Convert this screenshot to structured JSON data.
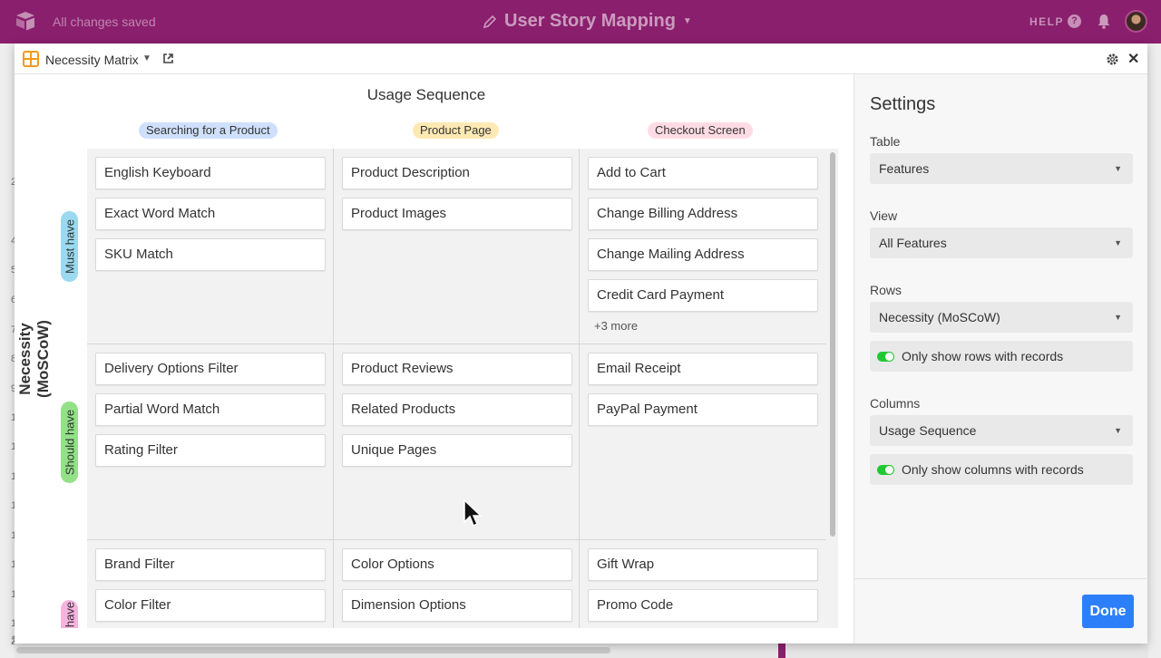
{
  "topbar": {
    "saved_status": "All changes saved",
    "base_name": "User Story Mapping",
    "help_label": "HELP",
    "help_icon": "?"
  },
  "background_row_numbers": [
    "2",
    "4",
    "5",
    "6",
    "7",
    "8",
    "9",
    "1",
    "1",
    "1",
    "1",
    "1",
    "1",
    "1",
    "1",
    "1",
    "2"
  ],
  "block": {
    "name": "Necessity Matrix",
    "close_glyph": "✕"
  },
  "matrix": {
    "column_field": "Usage Sequence",
    "row_field": "Necessity (MoSCoW)",
    "columns": [
      "Searching for a Product",
      "Product Page",
      "Checkout Screen"
    ],
    "rows": [
      "Must have",
      "Should have",
      "have"
    ],
    "cells": {
      "r0c0": [
        "English Keyboard",
        "Exact Word Match",
        "SKU Match"
      ],
      "r0c1": [
        "Product Description",
        "Product Images"
      ],
      "r0c2": [
        "Add to Cart",
        "Change Billing Address",
        "Change Mailing Address",
        "Credit Card Payment"
      ],
      "r0c2_more": "+3 more",
      "r1c0": [
        "Delivery Options Filter",
        "Partial Word Match",
        "Rating Filter"
      ],
      "r1c1": [
        "Product Reviews",
        "Related Products",
        "Unique Pages"
      ],
      "r1c2": [
        "Email Receipt",
        "PayPal Payment"
      ],
      "r2c0": [
        "Brand Filter",
        "Color Filter"
      ],
      "r2c1": [
        "Color Options",
        "Dimension Options"
      ],
      "r2c2": [
        "Gift Wrap",
        "Promo Code"
      ]
    }
  },
  "settings": {
    "heading": "Settings",
    "table_label": "Table",
    "table_value": "Features",
    "view_label": "View",
    "view_value": "All Features",
    "rows_label": "Rows",
    "rows_value": "Necessity (MoSCoW)",
    "rows_toggle_label": "Only show rows with records",
    "rows_toggle_on": true,
    "columns_label": "Columns",
    "columns_value": "Usage Sequence",
    "columns_toggle_label": "Only show columns with records",
    "columns_toggle_on": true,
    "done_label": "Done"
  },
  "colors": {
    "topbar": "#8a1f6d",
    "primary_button": "#2d7ff9",
    "toggle_on": "#20c933",
    "pill_blue": "#cfe0fc",
    "pill_yellow": "#ffe9b3",
    "pill_pink": "#ffdce5",
    "row_blue": "#9ad9f0",
    "row_green": "#93e088",
    "row_pink": "#f5b3e0"
  }
}
